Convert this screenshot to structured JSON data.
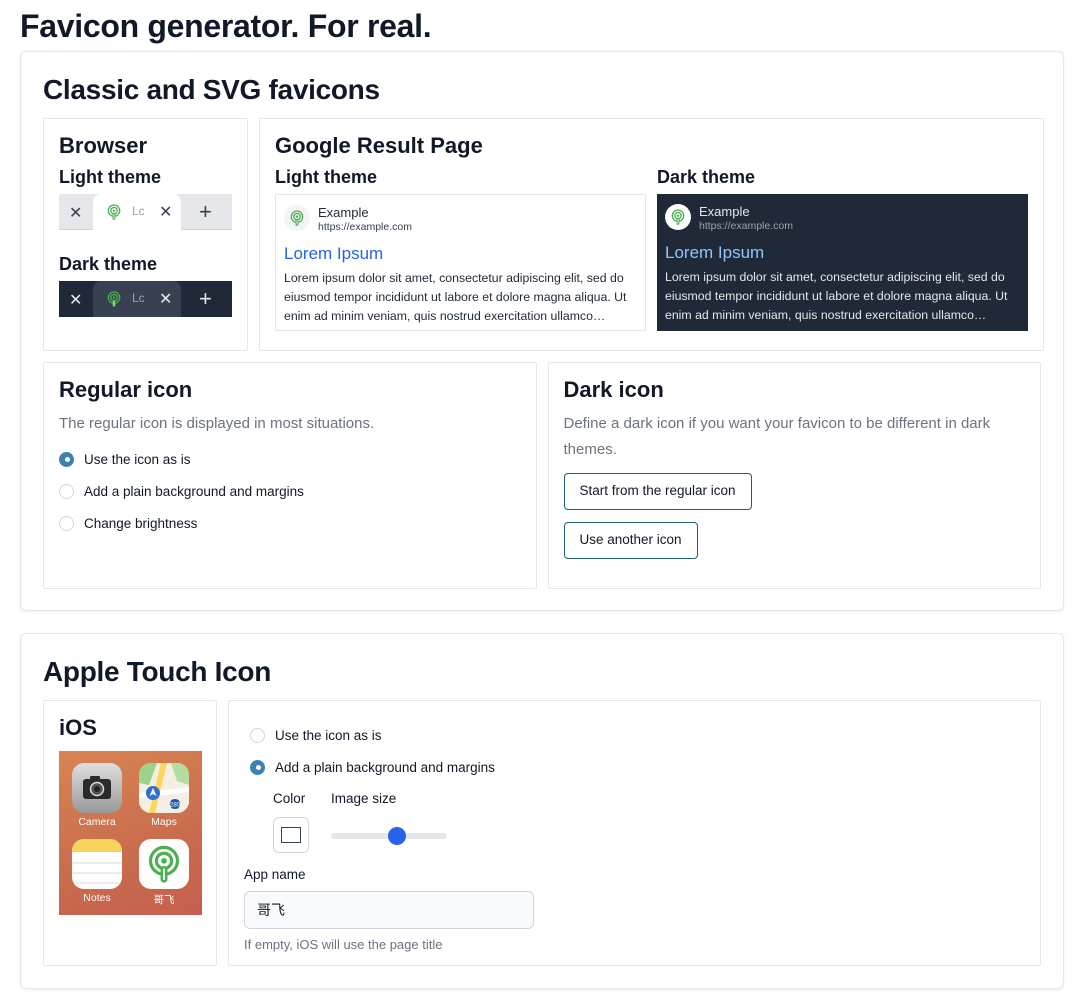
{
  "page": {
    "title": "Favicon generator. For real."
  },
  "classic": {
    "title": "Classic and SVG favicons",
    "browser": {
      "title": "Browser",
      "light_label": "Light theme",
      "dark_label": "Dark theme",
      "tab_text": "Lc",
      "close_glyph": "✕",
      "new_tab_glyph": "+"
    },
    "serp": {
      "title": "Google Result Page",
      "light_label": "Light theme",
      "dark_label": "Dark theme",
      "site_name": "Example",
      "site_url": "https://example.com",
      "result_title": "Lorem Ipsum",
      "result_snippet": "Lorem ipsum dolor sit amet, consectetur adipiscing elit, sed do eiusmod tempor incididunt ut labore et dolore magna aliqua. Ut enim ad minim veniam, quis nostrud exercitation ullamco…"
    },
    "regular": {
      "title": "Regular icon",
      "description": "The regular icon is displayed in most situations.",
      "options": [
        "Use the icon as is",
        "Add a plain background and margins",
        "Change brightness"
      ],
      "selected": 0
    },
    "dark": {
      "title": "Dark icon",
      "description": "Define a dark icon if you want your favicon to be different in dark themes.",
      "start_button": "Start from the regular icon",
      "another_button": "Use another icon"
    }
  },
  "apple": {
    "title": "Apple Touch Icon",
    "ios": {
      "title": "iOS",
      "apps": [
        "Camera",
        "Maps",
        "Notes",
        "哥飞"
      ]
    },
    "options": [
      "Use the icon as is",
      "Add a plain background and margins"
    ],
    "selected": 1,
    "color_label": "Color",
    "image_size_label": "Image size",
    "image_size_value": 0.58,
    "app_name_label": "App name",
    "app_name_value": "哥飞",
    "app_name_help": "If empty, iOS will use the page title"
  },
  "colors": {
    "accent": "#3b82b0",
    "slider_thumb": "#2563eb",
    "icon_green": "#4caf50",
    "button_border": "#1f5f6e"
  }
}
